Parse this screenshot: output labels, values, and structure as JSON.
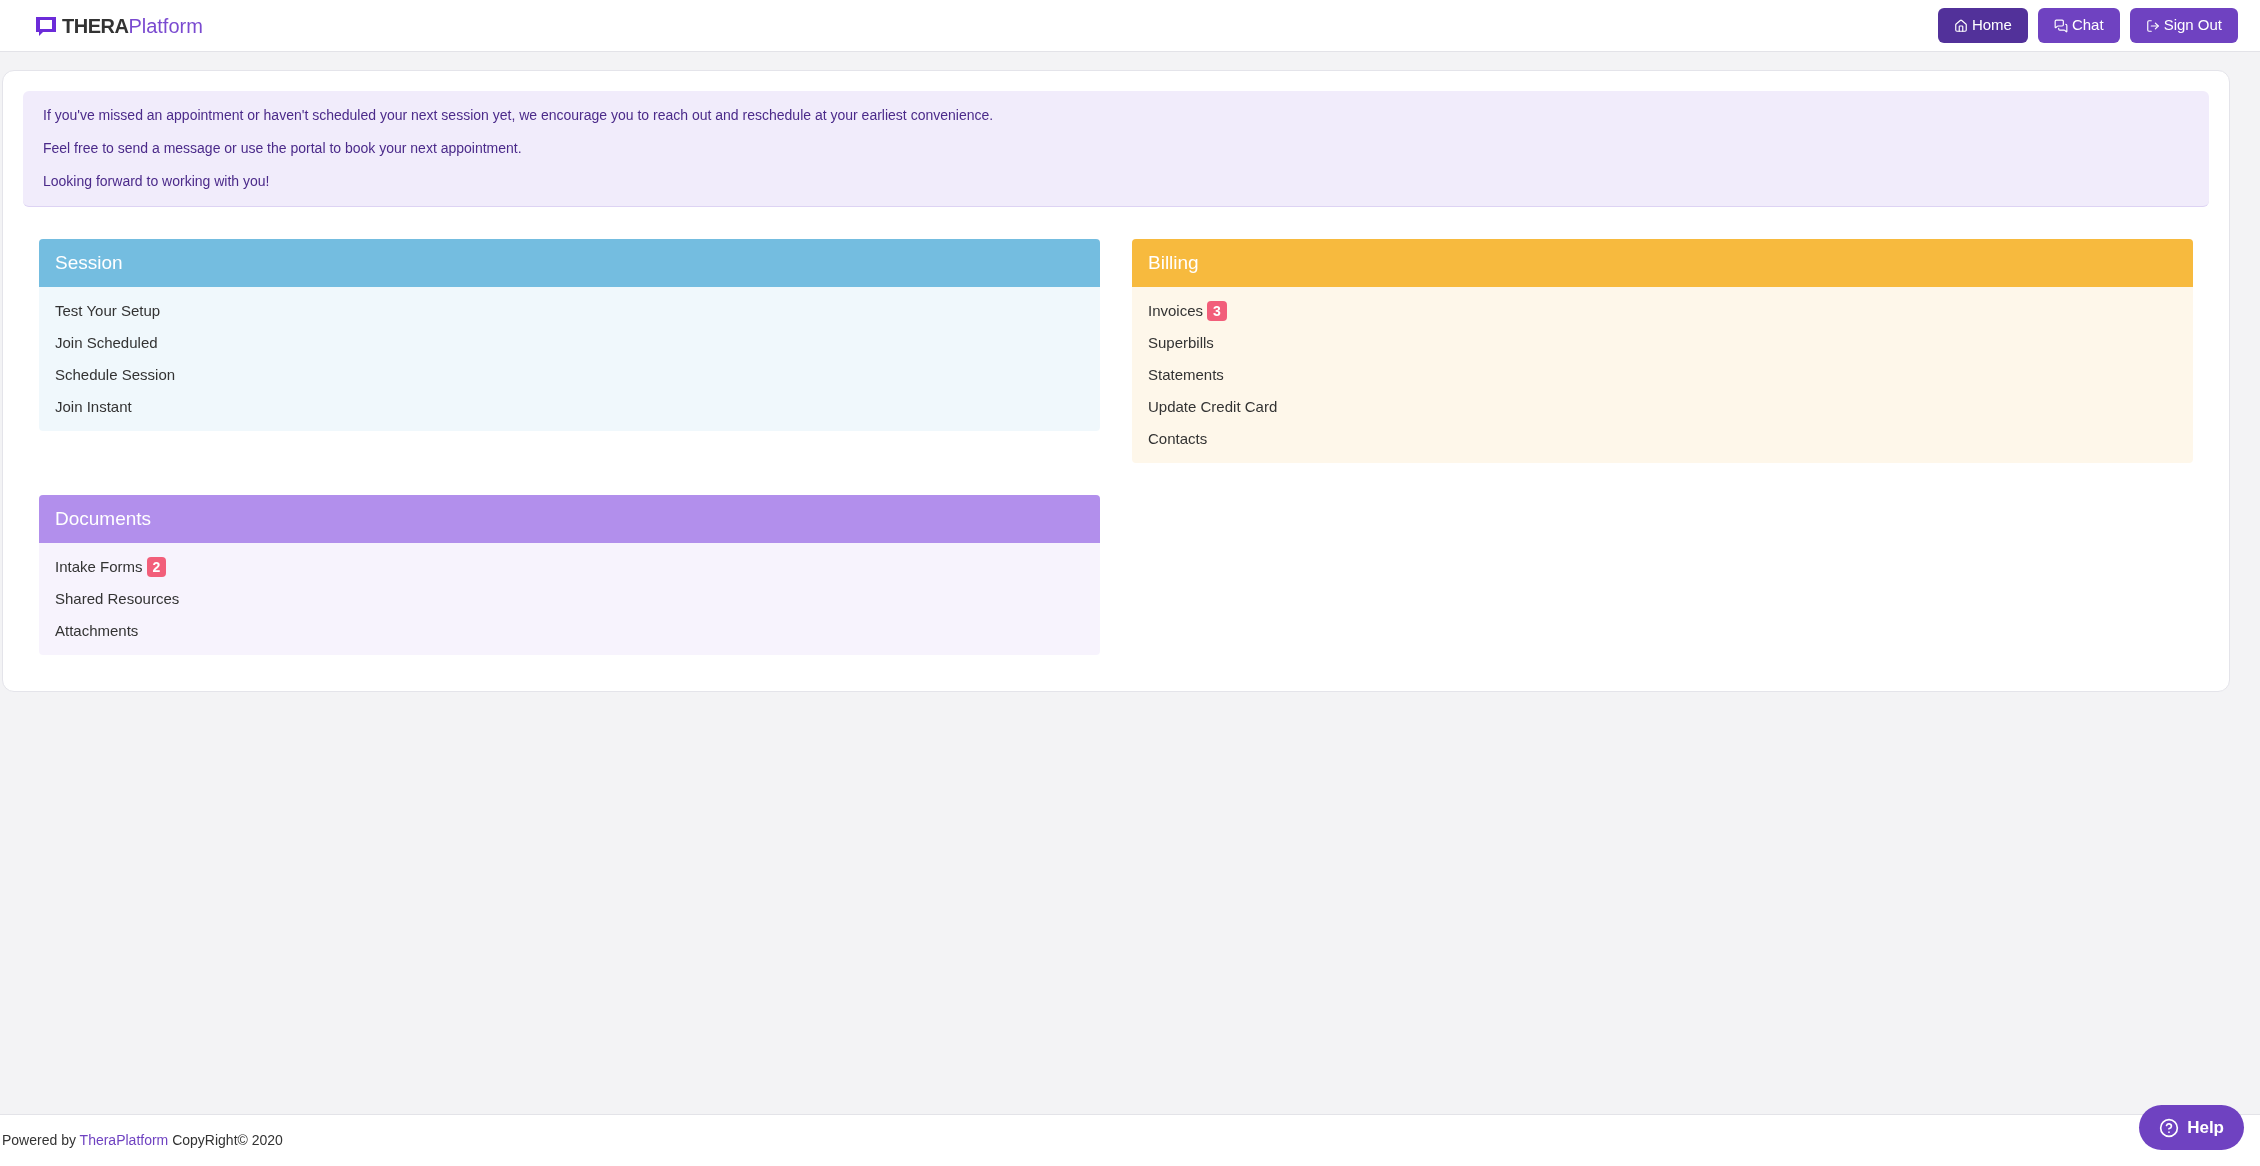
{
  "logo": {
    "bold": "THERA",
    "light": "Platform"
  },
  "nav": [
    {
      "label": "Home",
      "kind": "home",
      "selected": true
    },
    {
      "label": "Chat",
      "kind": "chat",
      "selected": false
    },
    {
      "label": "Sign Out",
      "kind": "signout",
      "selected": false
    }
  ],
  "notice": [
    "If you've missed an appointment or haven't scheduled your next session yet, we encourage you to reach out and reschedule at your earliest convenience.",
    "Feel free to send a message or use the portal to book your next appointment.",
    "Looking forward to working with you!"
  ],
  "panels": [
    {
      "title": "Session",
      "color": "#74bde0",
      "items": [
        {
          "label": "Test Your Setup"
        },
        {
          "label": "Join Scheduled"
        },
        {
          "label": "Schedule Session"
        },
        {
          "label": "Join Instant"
        }
      ]
    },
    {
      "title": "Billing",
      "color": "#f7ba3e",
      "items": [
        {
          "label": "Invoices",
          "badge": "3"
        },
        {
          "label": "Superbills"
        },
        {
          "label": "Statements"
        },
        {
          "label": "Update Credit Card"
        },
        {
          "label": "Contacts"
        }
      ]
    },
    {
      "title": "Documents",
      "color": "#b28fec",
      "items": [
        {
          "label": "Intake Forms",
          "badge": "2"
        },
        {
          "label": "Shared Resources"
        },
        {
          "label": "Attachments"
        }
      ]
    }
  ],
  "footer": {
    "prefix": "Powered by",
    "link": "TheraPlatform",
    "suffix": "CopyRight© 2020"
  },
  "help": {
    "label": "Help"
  }
}
